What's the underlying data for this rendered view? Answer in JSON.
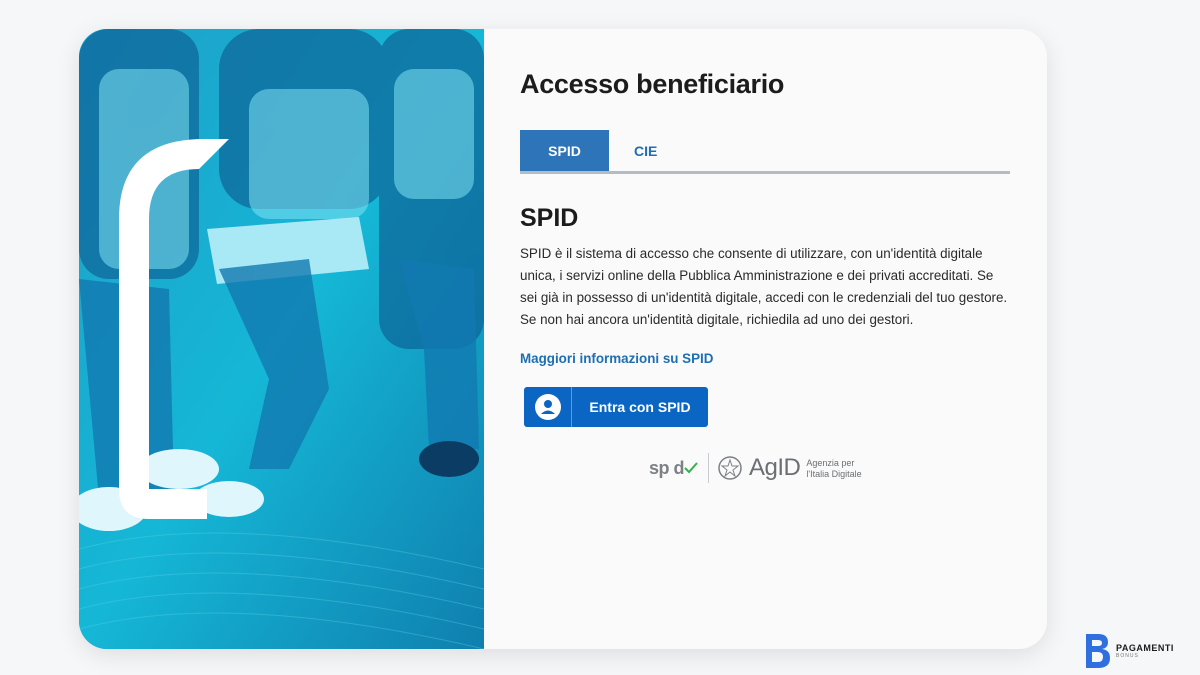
{
  "page": {
    "title": "Accesso beneficiario"
  },
  "tabs": [
    {
      "label": "SPID",
      "active": true
    },
    {
      "label": "CIE",
      "active": false
    }
  ],
  "spid_section": {
    "title": "SPID",
    "description": "SPID è il sistema di accesso che consente di utilizzare, con un'identità digitale unica, i servizi online della Pubblica Amministrazione e dei privati accreditati. Se sei già in possesso di un'identità digitale, accedi con le credenziali del tuo gestore. Se non hai ancora un'identità digitale, richiedila ad uno dei gestori.",
    "more_link": "Maggiori informazioni su SPID",
    "login_button": "Entra con SPID",
    "login_button_icon": "user-icon"
  },
  "logos": {
    "spid": "sp d",
    "agid": "AgID",
    "agid_subtitle_1": "Agenzia per",
    "agid_subtitle_2": "l'Italia Digitale"
  },
  "brand": {
    "name": "PAGAMENTI",
    "sub": "BONUS"
  },
  "colors": {
    "primary": "#0a66c2",
    "tab_active": "#2e74b9",
    "link": "#1e6eb4",
    "hero": "#1aa6c9"
  }
}
